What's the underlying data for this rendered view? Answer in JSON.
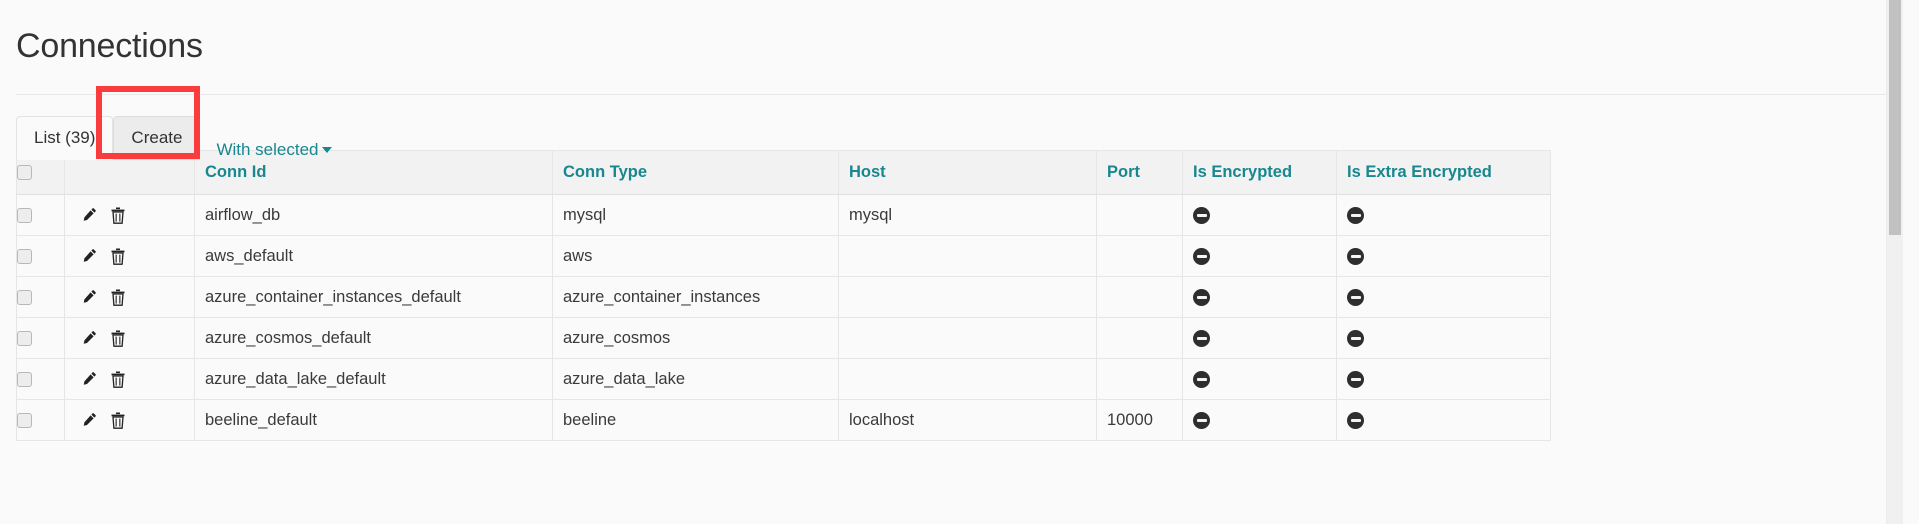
{
  "page": {
    "title": "Connections"
  },
  "toolbar": {
    "tabs": [
      {
        "label": "List (39)",
        "name": "tab-list",
        "active": false
      },
      {
        "label": "Create",
        "name": "tab-create",
        "active": true
      }
    ],
    "with_selected_label": "With selected",
    "caret_icon": "chevron-down-icon",
    "highlight_color": "#fa3c3c"
  },
  "table": {
    "columns": [
      {
        "key": "check",
        "label": ""
      },
      {
        "key": "actions",
        "label": ""
      },
      {
        "key": "conn_id",
        "label": "Conn Id"
      },
      {
        "key": "conn_type",
        "label": "Conn Type"
      },
      {
        "key": "host",
        "label": "Host"
      },
      {
        "key": "port",
        "label": "Port"
      },
      {
        "key": "is_encrypted",
        "label": "Is Encrypted"
      },
      {
        "key": "is_extra_encrypted",
        "label": "Is Extra Encrypted"
      }
    ],
    "header_color": "#18878e",
    "row_icons": {
      "edit": "pencil-icon",
      "delete": "trash-icon",
      "false_value": "minus-circle-icon"
    },
    "rows": [
      {
        "conn_id": "airflow_db",
        "conn_type": "mysql",
        "host": "mysql",
        "port": "",
        "is_encrypted": false,
        "is_extra_encrypted": false
      },
      {
        "conn_id": "aws_default",
        "conn_type": "aws",
        "host": "",
        "port": "",
        "is_encrypted": false,
        "is_extra_encrypted": false
      },
      {
        "conn_id": "azure_container_instances_default",
        "conn_type": "azure_container_instances",
        "host": "",
        "port": "",
        "is_encrypted": false,
        "is_extra_encrypted": false
      },
      {
        "conn_id": "azure_cosmos_default",
        "conn_type": "azure_cosmos",
        "host": "",
        "port": "",
        "is_encrypted": false,
        "is_extra_encrypted": false
      },
      {
        "conn_id": "azure_data_lake_default",
        "conn_type": "azure_data_lake",
        "host": "",
        "port": "",
        "is_encrypted": false,
        "is_extra_encrypted": false
      },
      {
        "conn_id": "beeline_default",
        "conn_type": "beeline",
        "host": "localhost",
        "port": "10000",
        "is_encrypted": false,
        "is_extra_encrypted": false
      }
    ]
  },
  "scrollbar": {
    "name": "vertical-scrollbar",
    "thumb_name": "scrollbar-thumb"
  }
}
